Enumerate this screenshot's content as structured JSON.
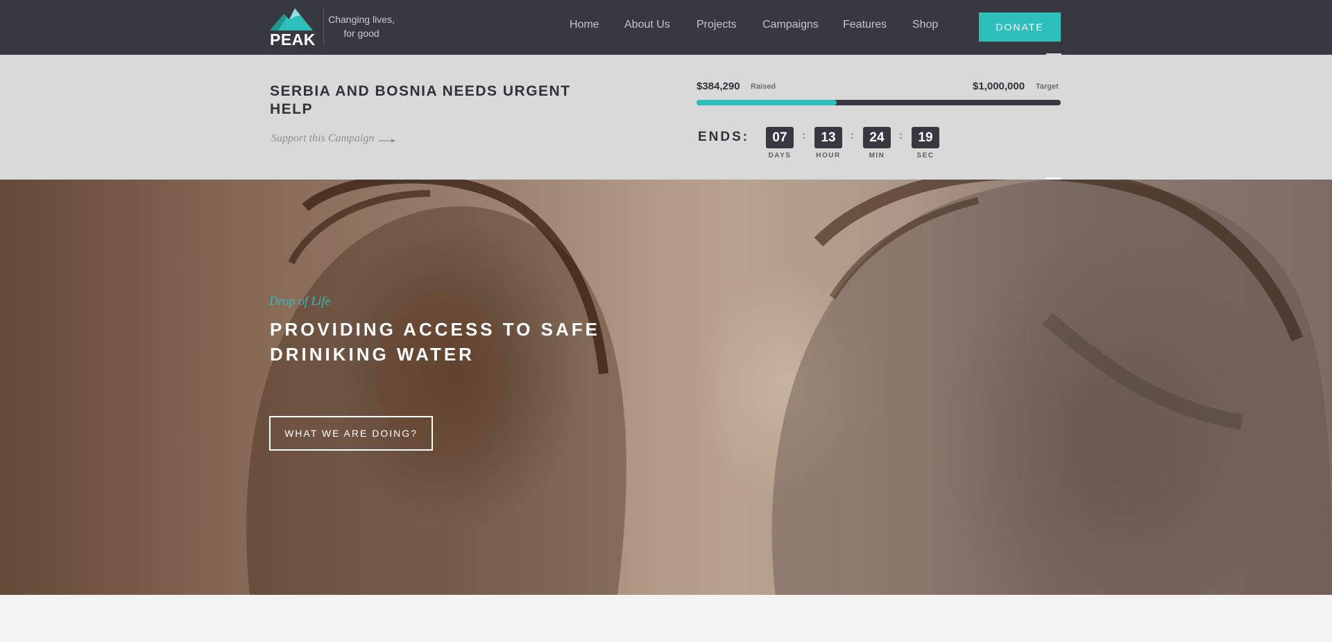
{
  "header": {
    "logo_text": "PEAK",
    "tagline_line1": "Changing lives,",
    "tagline_line2": "for good",
    "nav": [
      {
        "label": "Home"
      },
      {
        "label": "About Us"
      },
      {
        "label": "Projects"
      },
      {
        "label": "Campaigns"
      },
      {
        "label": "Features"
      },
      {
        "label": "Shop"
      }
    ],
    "donate_label": "DONATE"
  },
  "campaign": {
    "title": "SERBIA AND BOSNIA NEEDS URGENT HELP",
    "link_label": "Support this Campaign",
    "raised_amount": "$384,290",
    "raised_label": "Raised",
    "target_amount": "$1,000,000",
    "target_label": "Target",
    "progress_fraction": 0.3843,
    "ends_label": "ENDS:",
    "countdown": [
      {
        "value": "07",
        "label": "DAYS"
      },
      {
        "value": "13",
        "label": "HOUR"
      },
      {
        "value": "24",
        "label": "MIN"
      },
      {
        "value": "19",
        "label": "SEC"
      }
    ],
    "separator": ":"
  },
  "hero": {
    "subtitle": "Drop of Life",
    "title": "PROVIDING ACCESS TO SAFE DRINIKING WATER",
    "button_label": "WHAT WE ARE DOING?"
  },
  "colors": {
    "accent": "#2ebfba",
    "header_bg": "#363a40",
    "campaign_bg": "#d9d9d9"
  },
  "icons": {
    "logo": "mountain-logo-icon",
    "campaign_arrow": "long-arrow-right-icon",
    "scroll_up": "chevron-up-icon"
  }
}
